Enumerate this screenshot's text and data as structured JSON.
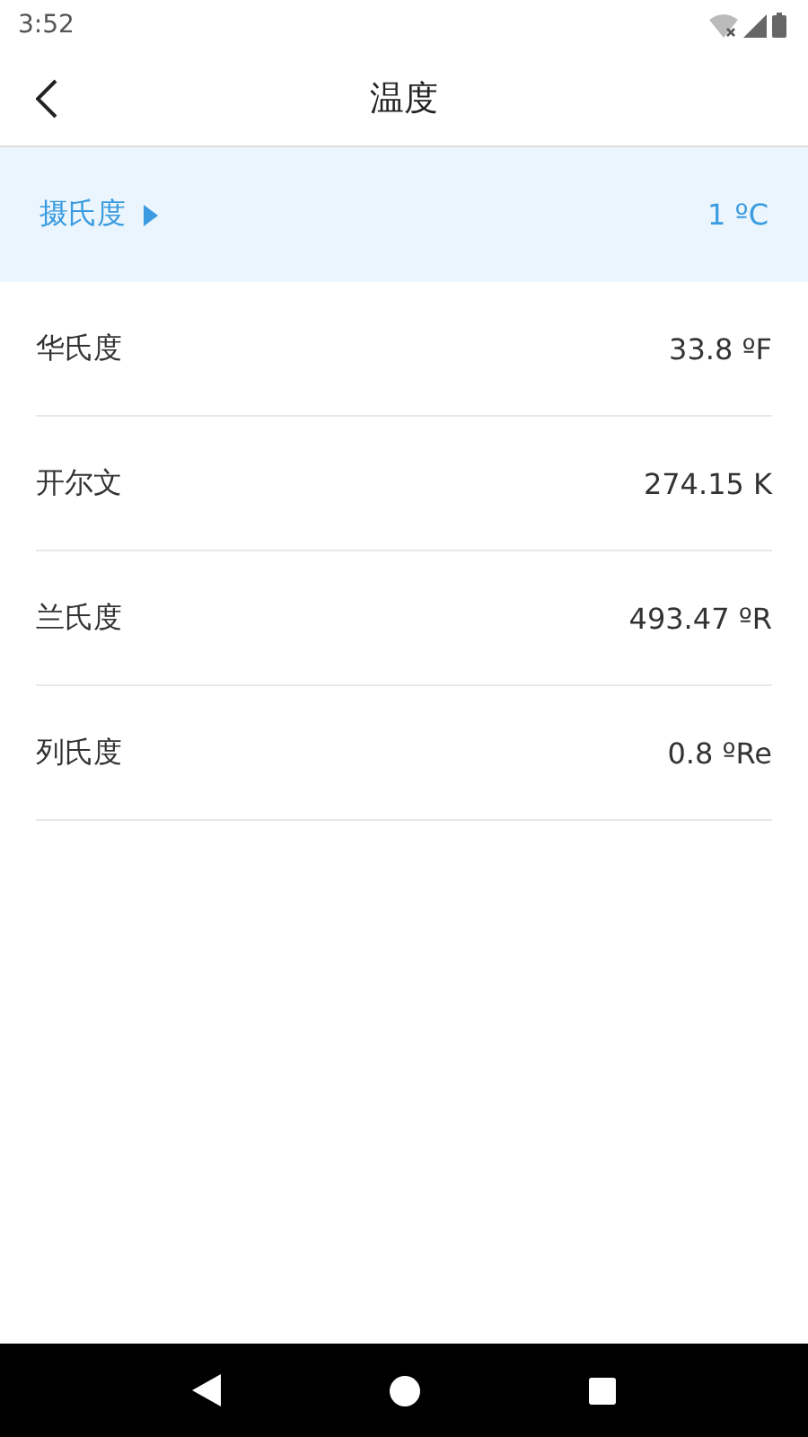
{
  "status_bar": {
    "time": "3:52"
  },
  "header": {
    "title": "温度"
  },
  "units": [
    {
      "name": "摄氏度",
      "value": "1 ºC",
      "selected": true
    },
    {
      "name": "华氏度",
      "value": "33.8 ºF",
      "selected": false
    },
    {
      "name": "开尔文",
      "value": "274.15 K",
      "selected": false
    },
    {
      "name": "兰氏度",
      "value": "493.47 ºR",
      "selected": false
    },
    {
      "name": "列氏度",
      "value": "0.8 ºRe",
      "selected": false
    }
  ]
}
